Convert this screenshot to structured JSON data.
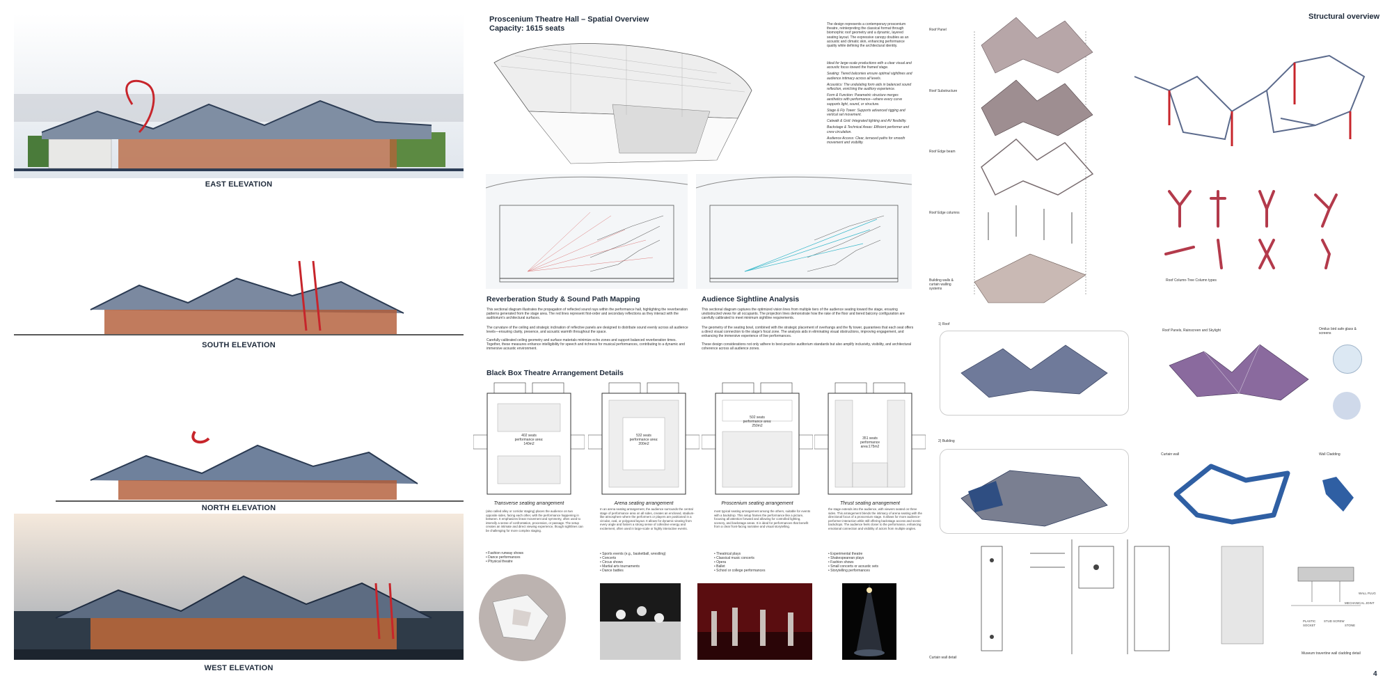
{
  "elevations": [
    {
      "label": "EAST ELEVATION"
    },
    {
      "label": "SOUTH ELEVATION"
    },
    {
      "label": "NORTH ELEVATION"
    },
    {
      "label": "WEST ELEVATION"
    }
  ],
  "hall": {
    "title": "Proscenium Theatre Hall – Spatial Overview",
    "capacity": "Capacity: 1615 seats",
    "intro": "The design represents a contemporary proscenium theatre, reinterpreting the classical format through biomorphic roof geometry and a dynamic, layered seating layout. The expressive canopy doubles as an acoustic and climatic skin, enhancing performance quality while defining the architectural identity.",
    "notes": [
      "Ideal for large-scale productions with a clear visual and acoustic focus toward the framed stage.",
      "Seating: Tiered balconies ensure optimal sightlines and audience intimacy across all levels.",
      "Acoustics: The undulating form aids in balanced sound reflection, enriching the auditory experience.",
      "Form & Function: Parametric structure merges aesthetics with performance—where every curve supports light, sound, or structure.",
      "Stage & Fly Tower: Supports advanced rigging and vertical set movement.",
      "Catwalk & Grid: Integrated lighting and AV flexibility.",
      "Backstage & Technical Areas: Efficient performer and crew circulation.",
      "Audience Access: Clear, terraced paths for smooth movement and visibility."
    ]
  },
  "reverb": {
    "title": "Reverberation Study & Sound Path Mapping",
    "p1": "This sectional diagram illustrates the propagation of reflected sound rays within the performance hall, highlighting the reverberation patterns generated from the stage area. The red lines represent first-order and secondary reflections as they interact with the auditorium's architectural surfaces.",
    "p2": "The curvature of the ceiling and strategic inclination of reflective panels are designed to distribute sound evenly across all audience levels—ensuring clarity, presence, and acoustic warmth throughout the space.",
    "p3": "Carefully calibrated ceiling geometry and surface materials minimize echo zones and support balanced reverberation times. Together, these measures enhance intelligibility for speech and richness for musical performances, contributing to a dynamic and immersive acoustic environment."
  },
  "sightline": {
    "title": "Audience Sightline Analysis",
    "p1": "This sectional diagram captures the optimized vision lines from multiple tiers of the audience seating toward the stage, ensuring unobstructed views for all occupants. The projection lines demonstrate how the rake of the floor and tiered balcony configuration are carefully calibrated to meet minimum sightline requirements.",
    "p2": "The geometry of the seating bowl, combined with the strategic placement of overhangs and the fly tower, guarantees that each seat offers a direct visual connection to the stage's focal zone. The analysis aids in eliminating visual obstructions, improving engagement, and enhancing the immersive experience of live performances.",
    "p3": "These design considerations not only adhere to best-practice auditorium standards but also amplify inclusivity, visibility, and architectural coherence across all audience zones."
  },
  "blackbox": {
    "title": "Black Box Theatre Arrangement Details",
    "plans": [
      {
        "seats": "402 seats",
        "area": "performance area:",
        "sqm": "140m2",
        "caption": "Transverse seating arrangement",
        "text": "(also called alley or corridor staging) places the audience on two opposite sides, facing each other, with the performance happening in between. It emphasizes linear movement and symmetry, often used to intensify a sense of confrontation, procession, or passage. The setup creates an intimate and direct viewing experience, though sightlines can be challenging for more complex staging.",
        "list": [
          "• Fashion runway shows",
          "• Dance performances",
          "• Physical theatre"
        ]
      },
      {
        "seats": "532 seats",
        "area": "performance area:",
        "sqm": "200m2",
        "caption": "Arena seating arrangement",
        "text": "In an arena seating arrangement, the audience surrounds the central stage of performance area on all sides, creates an enclosed, stadium-like atmosphere where the performers or players are positioned in a circular, oval, or polygonal layout. It allows for dynamic viewing from every angle and fosters a strong sense of collective energy and excitement, often used in large-scale or highly interactive events.",
        "list": [
          "• Sports events (e.g., basketball, wrestling)",
          "• Concerts",
          "• Circus shows",
          "• Martial arts tournaments",
          "• Dance battles"
        ]
      },
      {
        "seats": "502 seats",
        "area": "performance area:",
        "sqm": "250m2",
        "caption": "Proscenium seating arrangement",
        "text": "most typical seating arrangement among the others, suitable for events with a backdrop. This setup frames the performance like a picture, focusing all attention forward and allowing for controlled lighting, scenery, and backstage areas. It is ideal for performances that benefit from a clear front-facing narrative and visual storytelling.",
        "list": [
          "• Theatrical plays",
          "• Classical music concerts",
          "• Opera",
          "• Ballet",
          "• School or college performances"
        ]
      },
      {
        "seats": "351 seats",
        "area": "performance",
        "sqm": "area:175m2",
        "caption": "Thrust seating arrangement",
        "text": "the stage extends into the audience, with viewers seated on three sides. This arrangement blends the intimacy of arena seating with the directional focus of a proscenium stage. It allows for more audience-performer interaction while still offering backstage access and scenic backdrops. The audience feels closer to the performance, enhancing emotional connection and visibility of actors from multiple angles.",
        "list": [
          "• Experimental theatre",
          "• Shakespearean plays",
          "• Fashion shows",
          "• Small concerts or acoustic sets",
          "• Storytelling performances"
        ]
      }
    ]
  },
  "structure": {
    "title": "Structural overview",
    "layers": [
      "Roof Panel",
      "Roof Substructure",
      "Roof Edge beam",
      "Roof Edge columns",
      "Building walls & curtain walling systems"
    ],
    "column_caption": "Roof Column-Tree Column types",
    "roof_label": "1) Roof",
    "building_label": "2) Building",
    "roof_panels_label": "Roof Panels, Rainscreen and Skylight",
    "glass_label": "Omilux bird safe glass & screens",
    "curtain_label": "Curtain wall",
    "cladding_label": "Wall Cladding",
    "curtain_detail": "Curtain wall detail",
    "travertine_detail": "Museum travertine wall cladding detail",
    "detail_labels": [
      "WALL PLUG",
      "MECHANICAL JOINT",
      "PLASTIC SOCKET",
      "STUD SCREW",
      "STONE"
    ]
  },
  "page_number": "4"
}
